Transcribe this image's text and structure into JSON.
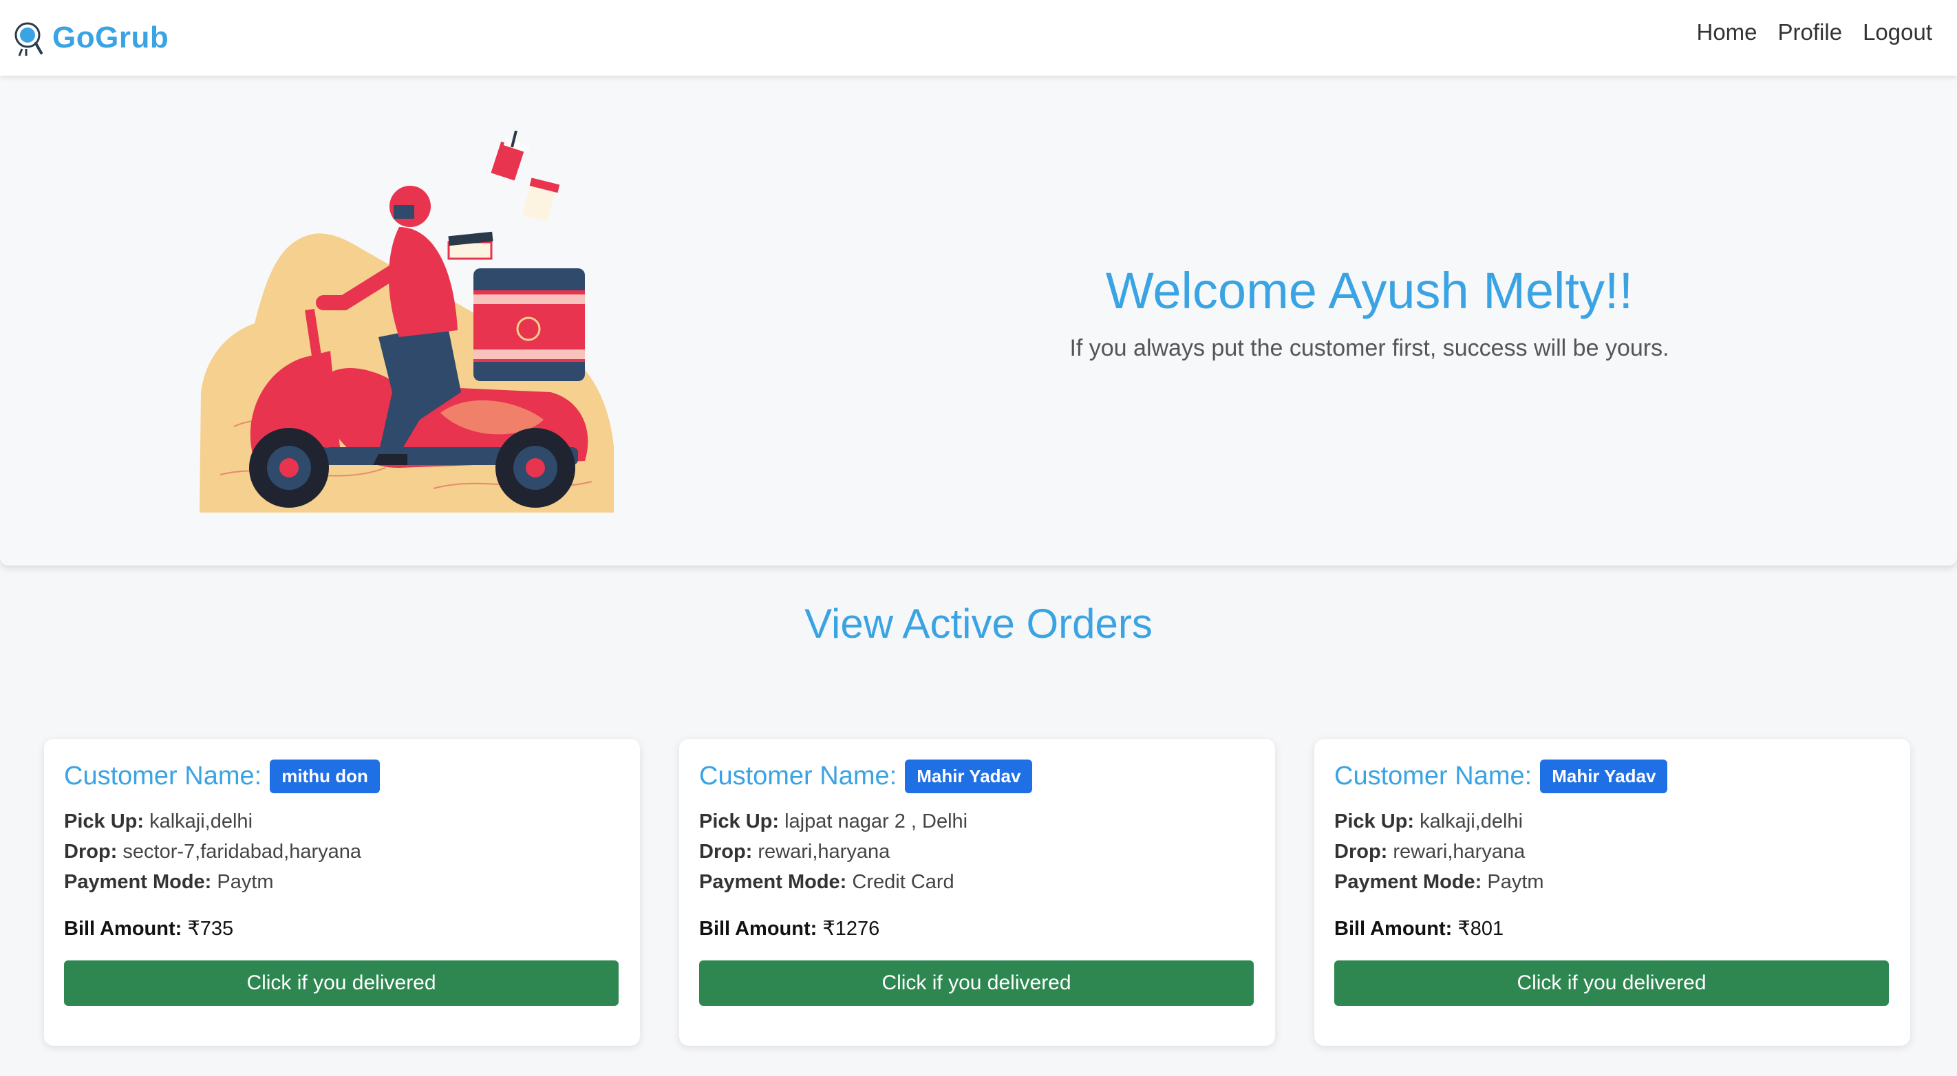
{
  "brand": {
    "name": "GoGrub"
  },
  "nav": {
    "links": [
      "Home",
      "Profile",
      "Logout"
    ]
  },
  "hero": {
    "welcome": "Welcome Ayush Melty!!",
    "quote": "If you always put the customer first, success will be yours."
  },
  "section": {
    "title": "View Active Orders"
  },
  "labels": {
    "customer": "Customer Name:",
    "pickup": "Pick Up:",
    "drop": "Drop:",
    "payment": "Payment Mode:",
    "bill": "Bill Amount:"
  },
  "orders": [
    {
      "customer": "mithu don",
      "pickup": "kalkaji,delhi",
      "drop": "sector-7,faridabad,haryana",
      "payment": "Paytm",
      "bill": "₹735",
      "button": "Click if you delivered"
    },
    {
      "customer": "Mahir Yadav",
      "pickup": "lajpat nagar 2 , Delhi",
      "drop": "rewari,haryana",
      "payment": "Credit Card",
      "bill": "₹1276",
      "button": "Click if you delivered"
    },
    {
      "customer": "Mahir Yadav",
      "pickup": "kalkaji,delhi",
      "drop": "rewari,haryana",
      "payment": "Paytm",
      "bill": "₹801",
      "button": "Click if you delivered"
    }
  ],
  "colors": {
    "accent": "#3aa3e3",
    "badge": "#1f6fe5",
    "button": "#2e8750"
  },
  "icons": {
    "brand": "food-delivery-logo-icon",
    "hero": "scooter-delivery-illustration"
  }
}
